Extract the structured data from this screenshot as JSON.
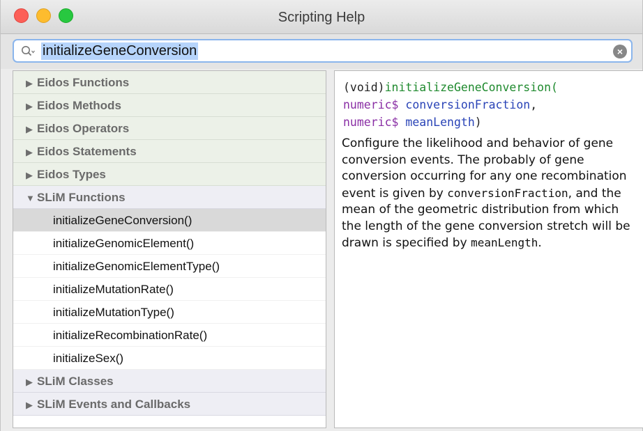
{
  "window": {
    "title": "Scripting Help"
  },
  "search": {
    "value": "initializeGeneConversion",
    "search_icon": "magnifier-with-dropdown-icon",
    "clear_icon": "clear-x-icon"
  },
  "sidebar": {
    "groups": [
      {
        "label": "Eidos Functions",
        "expanded": false,
        "disclosure": "▶"
      },
      {
        "label": "Eidos Methods",
        "expanded": false,
        "disclosure": "▶"
      },
      {
        "label": "Eidos Operators",
        "expanded": false,
        "disclosure": "▶"
      },
      {
        "label": "Eidos Statements",
        "expanded": false,
        "disclosure": "▶"
      },
      {
        "label": "Eidos Types",
        "expanded": false,
        "disclosure": "▶"
      },
      {
        "label": "SLiM Functions",
        "expanded": true,
        "disclosure": "▼"
      },
      {
        "label": "SLiM Classes",
        "expanded": false,
        "disclosure": "▶"
      },
      {
        "label": "SLiM Events and Callbacks",
        "expanded": false,
        "disclosure": "▶"
      }
    ],
    "slim_function_items": [
      {
        "label": "initializeGeneConversion()",
        "selected": true
      },
      {
        "label": "initializeGenomicElement()",
        "selected": false
      },
      {
        "label": "initializeGenomicElementType()",
        "selected": false
      },
      {
        "label": "initializeMutationRate()",
        "selected": false
      },
      {
        "label": "initializeMutationType()",
        "selected": false
      },
      {
        "label": "initializeRecombinationRate()",
        "selected": false
      },
      {
        "label": "initializeSex()",
        "selected": false
      }
    ]
  },
  "doc": {
    "return_type": "(void)",
    "function_name": "initializeGeneConversion(",
    "param1_type": "numeric$",
    "param1_name": "conversionFraction",
    "param1_sep": ",",
    "param2_type": "numeric$",
    "param2_name": "meanLength",
    "close_paren": ")",
    "desc_part1": "Configure the likelihood and behavior of gene conversion events.  The probably of gene conversion occurring for any one recombination event is given by ",
    "desc_code1": "conversionFraction",
    "desc_part2": ", and the mean of the geometric distribution from which the length of the gene conversion stretch will be drawn is specified by ",
    "desc_code2": "meanLength",
    "desc_part3": "."
  },
  "colors": {
    "eidos_group_bg": "#ecf1e8",
    "slim_group_bg": "#eeeef4",
    "selection_bg": "#d9d9d9",
    "search_highlight": "#b6d4fb",
    "function_name": "#1f8a2e",
    "param_type": "#8a2fa5",
    "param_name": "#2a44b7"
  }
}
